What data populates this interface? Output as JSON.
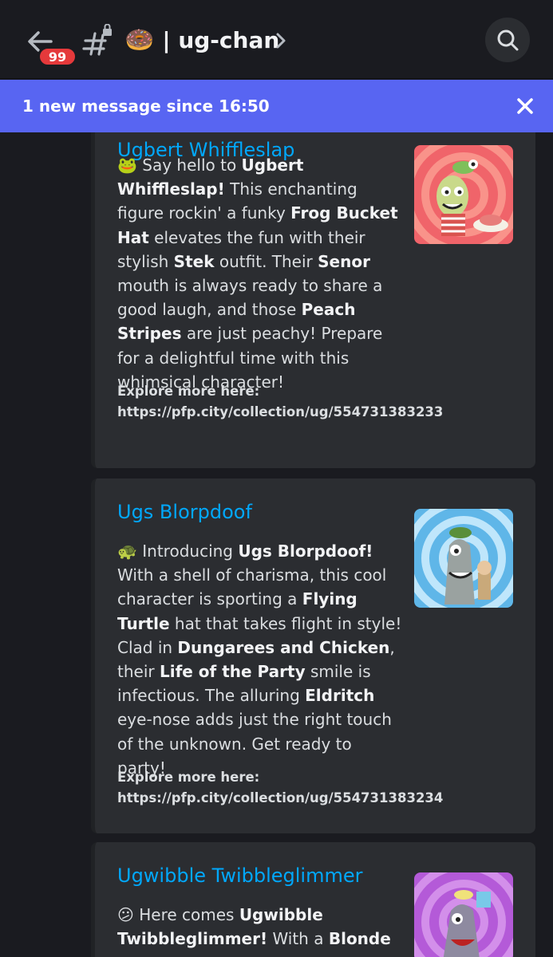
{
  "header": {
    "unread_count": "99",
    "channel_emoji": "🍩",
    "channel_name": "| ug-chan"
  },
  "banner": {
    "text": "1 new message since 16:50"
  },
  "cards": [
    {
      "title": "Ugbert Whiffleslap",
      "emoji": "🐸",
      "desc": [
        "Say hello to ",
        "Ugbert Whiffleslap!",
        " This enchanting figure rockin' a funky ",
        "Frog Bucket Hat",
        " elevates the fun with their stylish ",
        "Stek",
        " outfit. Their ",
        "Senor",
        " mouth is always ready to share a good laugh, and those ",
        "Peach Stripes",
        " are just peachy! Prepare for a delightful time with this whimsical character!"
      ],
      "link": "Explore more here: https://pfp.city/collection/ug/554731383233",
      "colors": {
        "bg": "#f0646a",
        "swirl": "#ffb3a0"
      }
    },
    {
      "title": "Ugs Blorpdoof",
      "emoji": "🐢",
      "desc": [
        "Introducing ",
        "Ugs Blorpdoof!",
        " With a shell of charisma, this cool character is sporting a ",
        "Flying Turtle",
        " hat that takes flight in style! Clad in ",
        "Dungarees and Chicken",
        ", their ",
        "Life of the Party",
        " smile is infectious. The alluring ",
        "Eldritch",
        " eye-nose adds just the right touch of the unknown. Get ready to party!"
      ],
      "link": "Explore more here: https://pfp.city/collection/ug/554731383234",
      "colors": {
        "bg": "#5fb6e8",
        "swirl": "#bfe6fb"
      }
    },
    {
      "title": "Ugwibble Twibbleglimmer",
      "emoji": "😕",
      "desc": [
        "Here comes ",
        "Ugwibble Twibbleglimmer!",
        " With a ",
        "Blonde"
      ],
      "link": "",
      "colors": {
        "bg": "#b45ad8",
        "swirl": "#e0a5f2"
      }
    }
  ]
}
